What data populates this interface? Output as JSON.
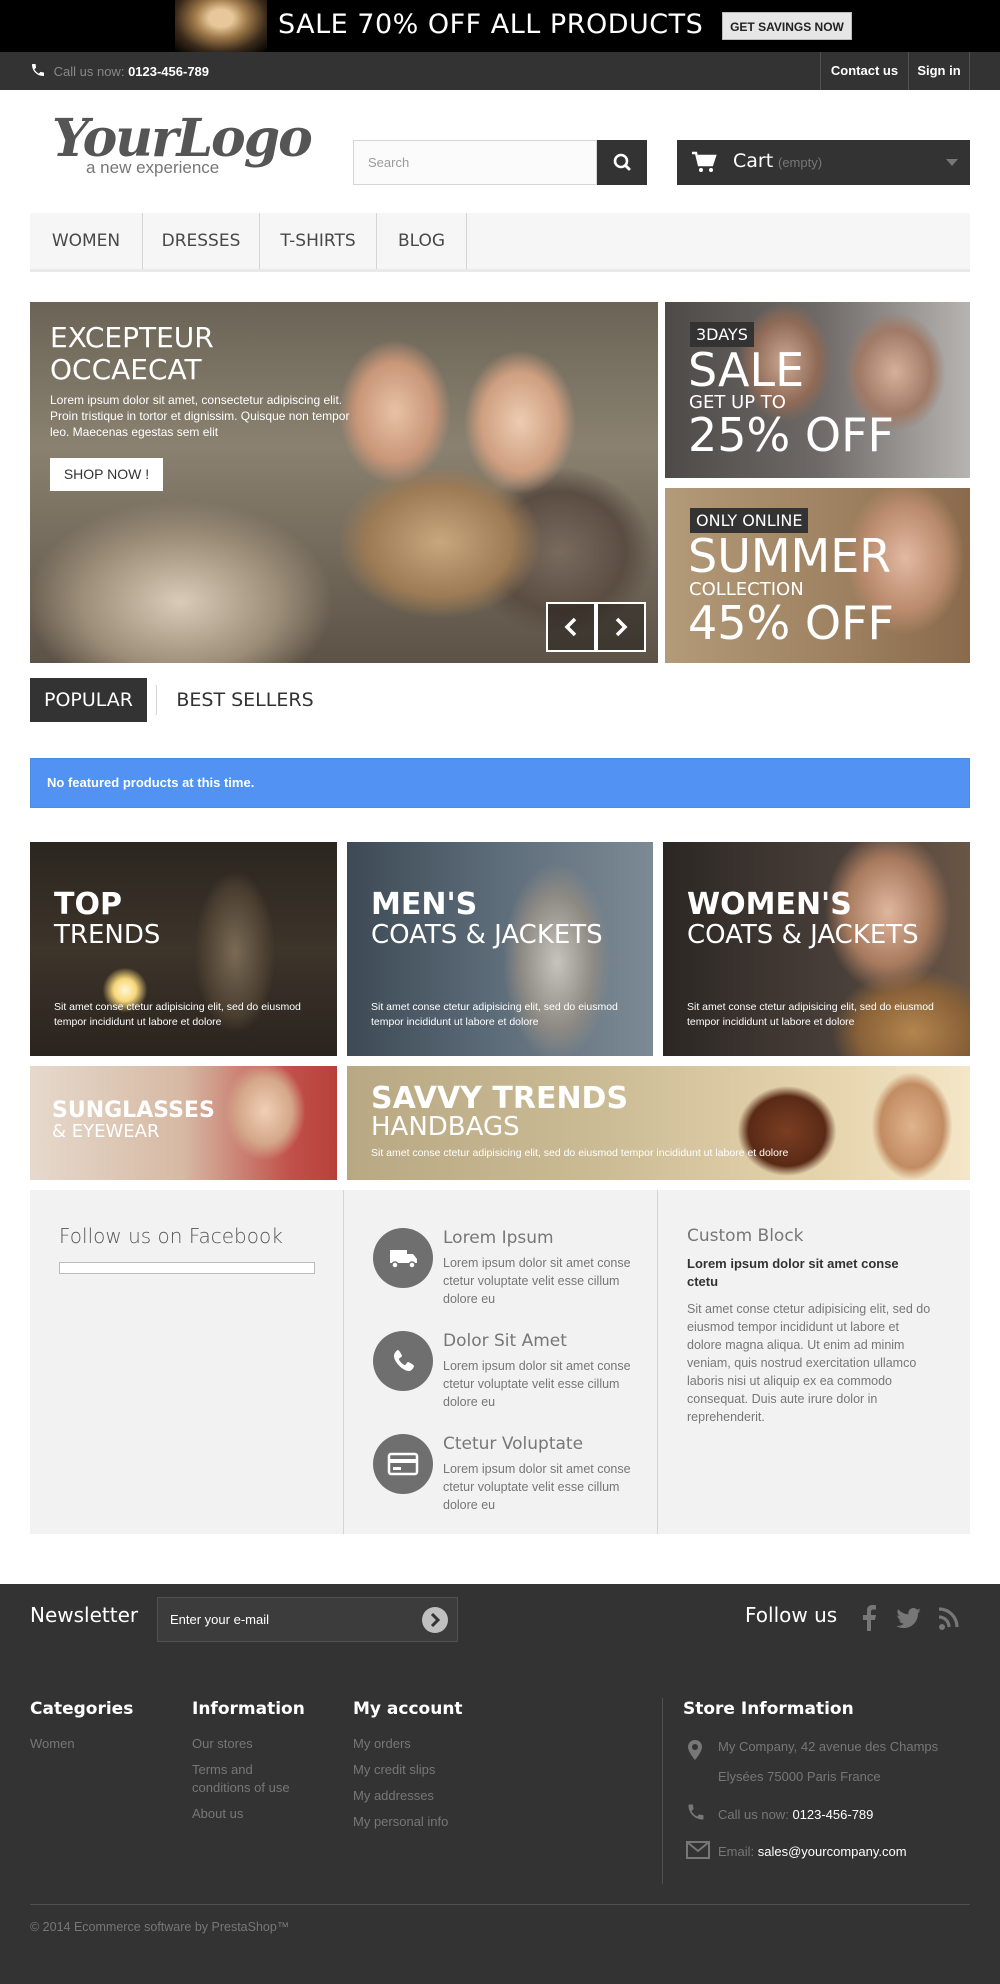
{
  "top_banner": {
    "headline": "SALE 70% OFF ALL PRODUCTS",
    "cta": "GET SAVINGS NOW"
  },
  "nav": {
    "phone_label": "Call us now:",
    "phone_number": "0123-456-789",
    "contact": "Contact us",
    "signin": "Sign in"
  },
  "header": {
    "logo_main": "YourLogo",
    "logo_sub": "a new experience",
    "search_placeholder": "Search",
    "cart_label": "Cart",
    "cart_status": "(empty)"
  },
  "menu": {
    "items": [
      {
        "label": "WOMEN"
      },
      {
        "label": "DRESSES"
      },
      {
        "label": "T-SHIRTS"
      },
      {
        "label": "BLOG"
      }
    ]
  },
  "slider": {
    "title": "EXCEPTEUR OCCAECAT",
    "text": "Lorem ipsum dolor sit amet, consectetur adipiscing elit. Proin tristique in tortor et dignissim. Quisque non tempor leo. Maecenas egestas sem elit",
    "button": "SHOP NOW !"
  },
  "promos": [
    {
      "badge": "3DAYS",
      "big": "SALE",
      "small": "GET UP TO",
      "value": "25% OFF"
    },
    {
      "badge": "ONLY ONLINE",
      "big": "SUMMER",
      "small": "COLLECTION",
      "value": "45% OFF"
    }
  ],
  "tabs": {
    "active": "POPULAR",
    "other": "BEST SELLERS"
  },
  "alert": {
    "message": "No featured products at this time."
  },
  "tiles": {
    "top": {
      "h1": "TOP",
      "h2": "TRENDS",
      "text": "Sit amet conse ctetur adipisicing elit, sed do eiusmod tempor incididunt ut labore et dolore"
    },
    "men": {
      "h1": "MEN'S",
      "h2": "COATS & JACKETS",
      "text": "Sit amet conse ctetur adipisicing elit, sed do eiusmod tempor incididunt ut labore et dolore"
    },
    "women": {
      "h1": "WOMEN'S",
      "h2": "COATS & JACKETS",
      "text": "Sit amet conse ctetur adipisicing elit, sed do eiusmod tempor incididunt ut labore et dolore"
    },
    "sun": {
      "h1": "SUNGLASSES",
      "h2": "& EYEWEAR"
    },
    "bags": {
      "h1": "SAVVY TRENDS",
      "h2": "HANDBAGS",
      "text": "Sit amet conse ctetur adipisicing elit, sed do eiusmod tempor incididunt ut labore et dolore"
    }
  },
  "info": {
    "facebook_title": "Follow us on Facebook",
    "services": [
      {
        "icon": "truck-icon",
        "title": "Lorem Ipsum",
        "text": "Lorem ipsum dolor sit amet conse ctetur voluptate velit esse cillum dolore eu"
      },
      {
        "icon": "phone-icon",
        "title": "Dolor Sit Amet",
        "text": "Lorem ipsum dolor sit amet conse ctetur voluptate velit esse cillum dolore eu"
      },
      {
        "icon": "credit-card-icon",
        "title": "Ctetur Voluptate",
        "text": "Lorem ipsum dolor sit amet conse ctetur voluptate velit esse cillum dolore eu"
      }
    ],
    "custom_block": {
      "title": "Custom Block",
      "subtitle": "Lorem ipsum dolor sit amet conse ctetu",
      "text": "Sit amet conse ctetur adipisicing elit, sed do eiusmod tempor incididunt ut labore et dolore magna aliqua. Ut enim ad minim veniam, quis nostrud exercitation ullamco laboris nisi ut aliquip ex ea commodo consequat. Duis aute irure dolor in reprehenderit."
    }
  },
  "newsletter": {
    "title": "Newsletter",
    "placeholder": "Enter your e-mail",
    "follow_title": "Follow us"
  },
  "footer": {
    "categories": {
      "title": "Categories",
      "links": [
        "Women"
      ]
    },
    "information": {
      "title": "Information",
      "links": [
        "Our stores",
        "Terms and conditions of use",
        "About us"
      ]
    },
    "account": {
      "title": "My account",
      "links": [
        "My orders",
        "My credit slips",
        "My addresses",
        "My personal info"
      ]
    },
    "store": {
      "title": "Store Information",
      "address": "My Company, 42 avenue des Champs Elysées 75000 Paris France",
      "phone_label": "Call us now:",
      "phone": "0123-456-789",
      "email_label": "Email:",
      "email": "sales@yourcompany.com"
    },
    "copyright": "© 2014 Ecommerce software by PrestaShop™"
  },
  "colors": {
    "dark": "#333333",
    "alert_blue": "#5192f3",
    "info_bg": "#f2f2f2"
  }
}
